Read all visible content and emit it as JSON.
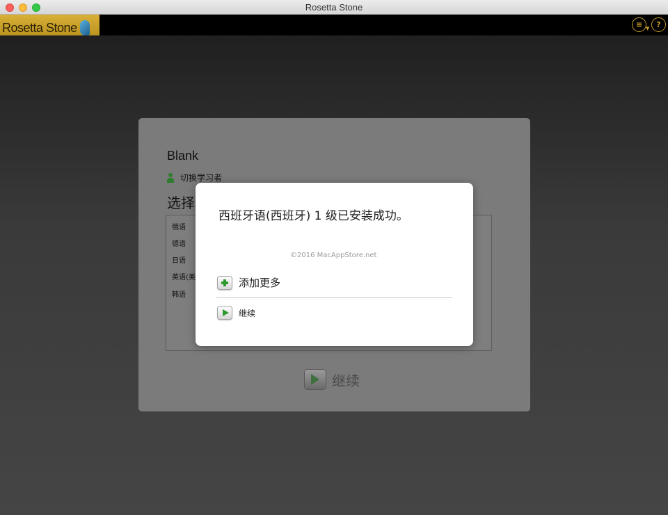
{
  "window": {
    "title": "Rosetta Stone"
  },
  "toolbar": {
    "logo_text": "Rosetta Stone",
    "menu_icon": "list-menu-icon",
    "help_icon": "help-icon",
    "help_glyph": "?"
  },
  "panel": {
    "user_name": "Blank",
    "switch_learner": "切换学习者",
    "select_heading": "选择",
    "languages": [
      "俄语",
      "德语",
      "日语",
      "英语(美",
      "韩语"
    ],
    "continue_label": "继续"
  },
  "modal": {
    "message": "西班牙语(西班牙) 1 级已安装成功。",
    "watermark": "©2016 MacAppStore.net",
    "add_more": "添加更多",
    "continue": "继续"
  }
}
